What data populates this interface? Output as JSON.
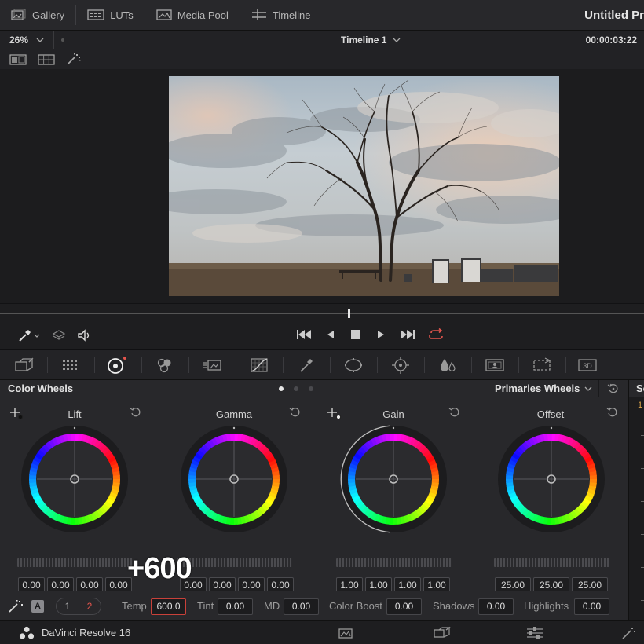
{
  "topbar": {
    "items": [
      {
        "label": "Gallery",
        "icon": "gallery-icon"
      },
      {
        "label": "LUTs",
        "icon": "luts-icon"
      },
      {
        "label": "Media Pool",
        "icon": "media-pool-icon"
      },
      {
        "label": "Timeline",
        "icon": "timeline-icon"
      }
    ],
    "project_title": "Untitled Pr"
  },
  "viewer_bar": {
    "zoom": "26%",
    "timeline_name": "Timeline 1",
    "timecode": "00:00:03:22"
  },
  "color_wheels": {
    "title": "Color Wheels",
    "mode": "Primaries Wheels",
    "page_dots": 3,
    "active_page": 0,
    "wheels": [
      {
        "name": "Lift",
        "values": [
          "0.00",
          "0.00",
          "0.00",
          "0.00"
        ]
      },
      {
        "name": "Gamma",
        "values": [
          "0.00",
          "0.00",
          "0.00",
          "0.00"
        ]
      },
      {
        "name": "Gain",
        "values": [
          "1.00",
          "1.00",
          "1.00",
          "1.00"
        ]
      },
      {
        "name": "Offset",
        "values": [
          "25.00",
          "25.00",
          "25.00"
        ]
      }
    ],
    "overlay_value": "+600"
  },
  "adjust_bar": {
    "auto_key": "A",
    "page_1": "1",
    "page_2": "2",
    "temp_label": "Temp",
    "temp_value": "600.0",
    "tint_label": "Tint",
    "tint_value": "0.00",
    "md_label": "MD",
    "md_value": "0.00",
    "boost_label": "Color Boost",
    "boost_value": "0.00",
    "shadows_label": "Shadows",
    "shadows_value": "0.00",
    "highlights_label": "Highlights",
    "highlights_value": "0.00"
  },
  "right_strip": {
    "head": "Sc",
    "number": "1"
  },
  "status": {
    "app_name": "DaVinci Resolve 16"
  },
  "colors": {
    "accent_red": "#e4554d",
    "panel": "#28282b",
    "bg": "#1a1a1c"
  }
}
